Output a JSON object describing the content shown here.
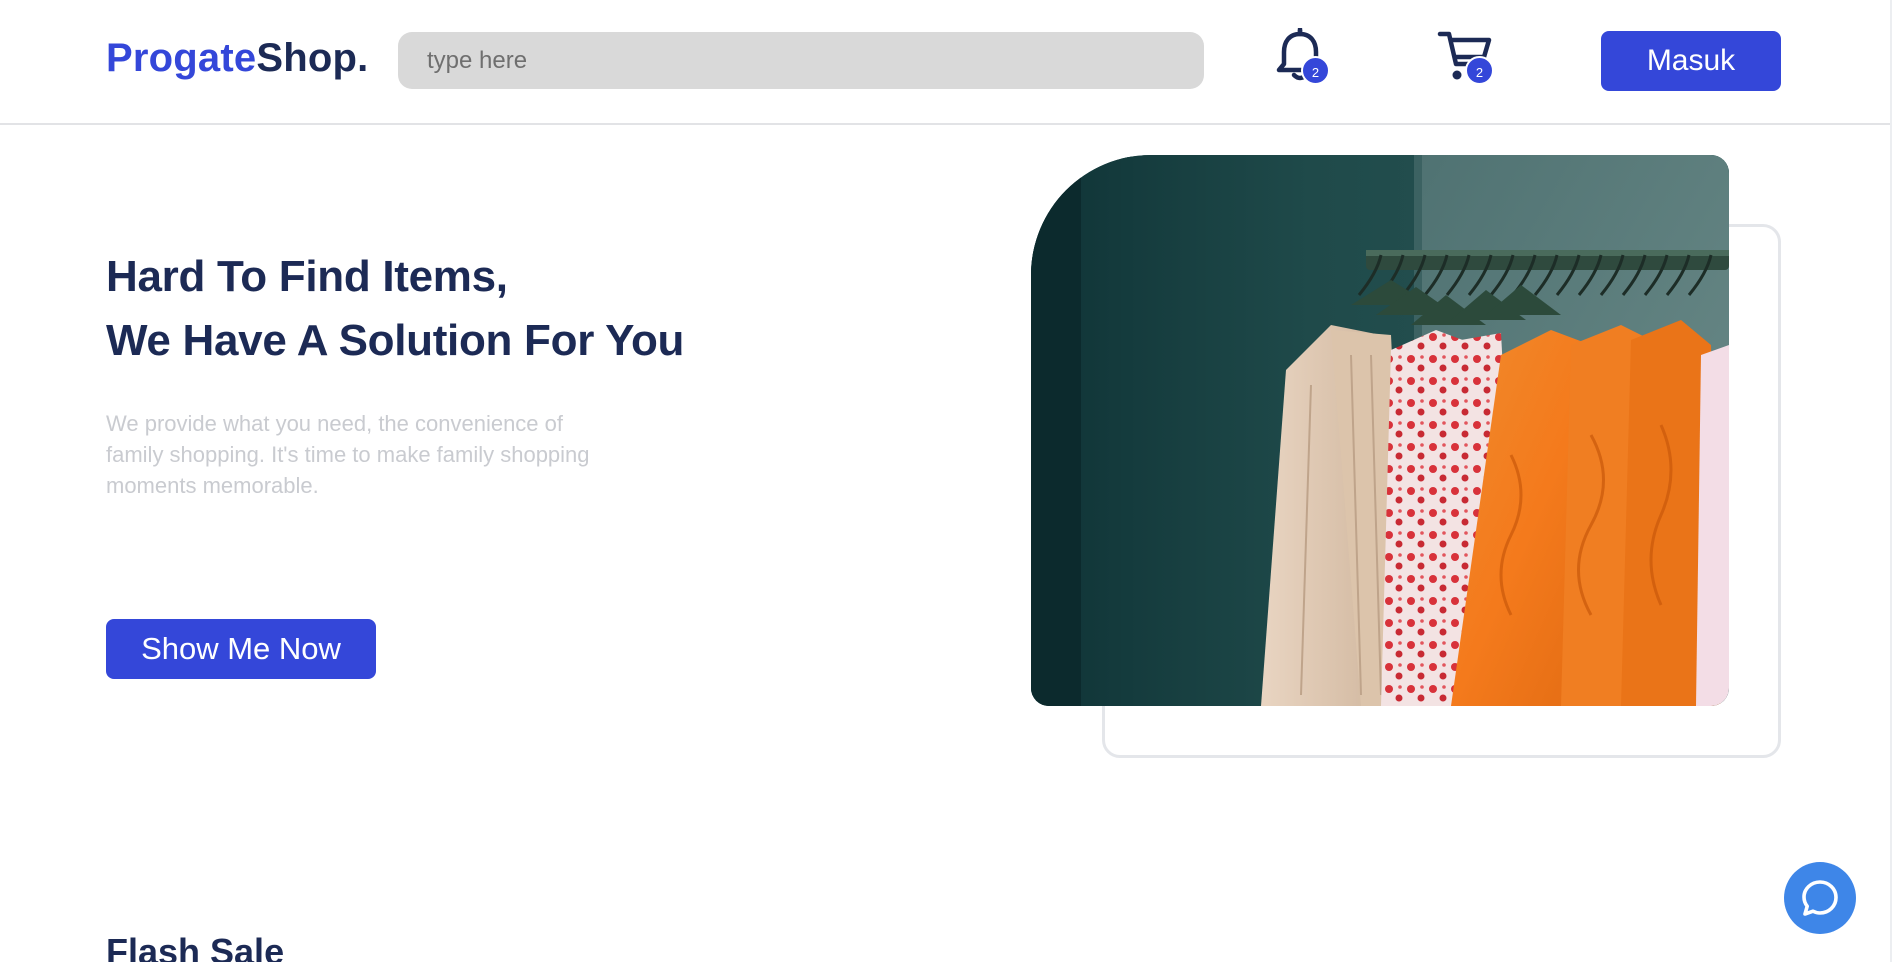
{
  "header": {
    "logo_brand": "Progate",
    "logo_suffix": "Shop.",
    "search_placeholder": "type here",
    "notifications": {
      "icon": "bell-icon",
      "count": "2"
    },
    "cart": {
      "icon": "cart-icon",
      "count": "2"
    },
    "login_label": "Masuk"
  },
  "hero": {
    "title_line1": "Hard To Find Items,",
    "title_line2": "We Have A Solution For You",
    "description": "We provide what you need, the convenience of family shopping. It's time to make family shopping moments memorable.",
    "cta_label": "Show Me Now"
  },
  "flash_sale": {
    "title": "Flash Sale"
  },
  "chat": {
    "icon": "chat-bubble-icon"
  },
  "colors": {
    "primary": "#3447d9",
    "dark_text": "#1c2a55",
    "muted_text": "#c9cbd0",
    "chat_fab": "#3e86e8"
  }
}
